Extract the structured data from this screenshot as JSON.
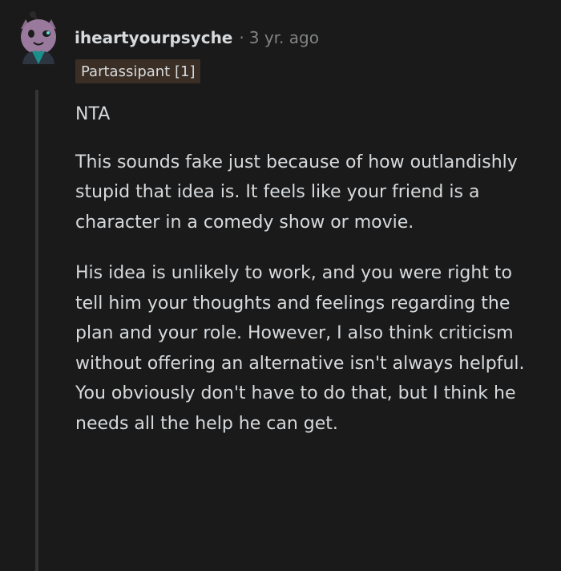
{
  "comment": {
    "username": "iheartyourpsyche",
    "separator": "·",
    "time": "3 yr. ago",
    "flair": "Partassipant [1]",
    "paragraphs": [
      "NTA",
      "This sounds fake just because of how outlandishly stupid that idea is. It feels like your friend is a character in a comedy show or movie.",
      "His idea is unlikely to work, and you were right to tell him your thoughts and feelings regarding the plan and your role. However, I also think criticism without offering an alternative isn't always helpful. You obviously don't have to do that, but I think he needs all the help he can get."
    ]
  },
  "colors": {
    "background": "#1a1a1b",
    "text": "#d7dadc",
    "meta": "#818384",
    "flair_bg": "#3a2e25",
    "thread_line": "#343536"
  },
  "icons": {
    "avatar": "snoo-avatar-icon"
  }
}
